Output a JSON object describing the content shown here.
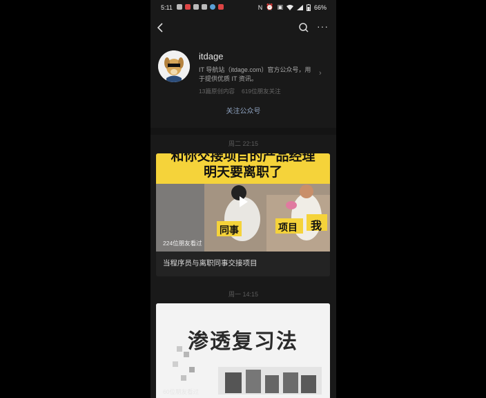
{
  "status_bar": {
    "time": "5:11",
    "battery": "66%",
    "left_icons": [
      "location-icon",
      "app-icon",
      "app-icon",
      "app-icon",
      "telegram-icon",
      "app-icon"
    ],
    "right_icons": [
      "nfc-icon",
      "alarm-icon",
      "sim-icon",
      "wifi-icon",
      "signal-icon",
      "battery-icon"
    ]
  },
  "navbar": {
    "back_icon": "chevron-left-icon",
    "search_icon": "search-icon",
    "more_label": "···"
  },
  "profile": {
    "name": "itdage",
    "description": "IT 导航站（itdage.com）官方公众号，用于提供优质 IT 资讯。",
    "original_count": "13篇原创内容",
    "friends_following": "619位朋友关注",
    "follow_label": "关注公众号"
  },
  "feed": [
    {
      "timestamp": "周二 22:15",
      "overlay_title_line1": "和你交接项目的产品经理",
      "overlay_title_line2": "明天要离职了",
      "overlay_labels": [
        "同事",
        "项目",
        "我"
      ],
      "views": "224位朋友看过",
      "title": "当程序员与离职同事交接项目"
    },
    {
      "timestamp": "周一 14:15",
      "overlay_text": "渗透复习法",
      "views": "60位朋友看过"
    }
  ],
  "colors": {
    "background": "#191919",
    "link_blue": "#8fa3c0",
    "yellow_banner": "#f5d33a"
  }
}
